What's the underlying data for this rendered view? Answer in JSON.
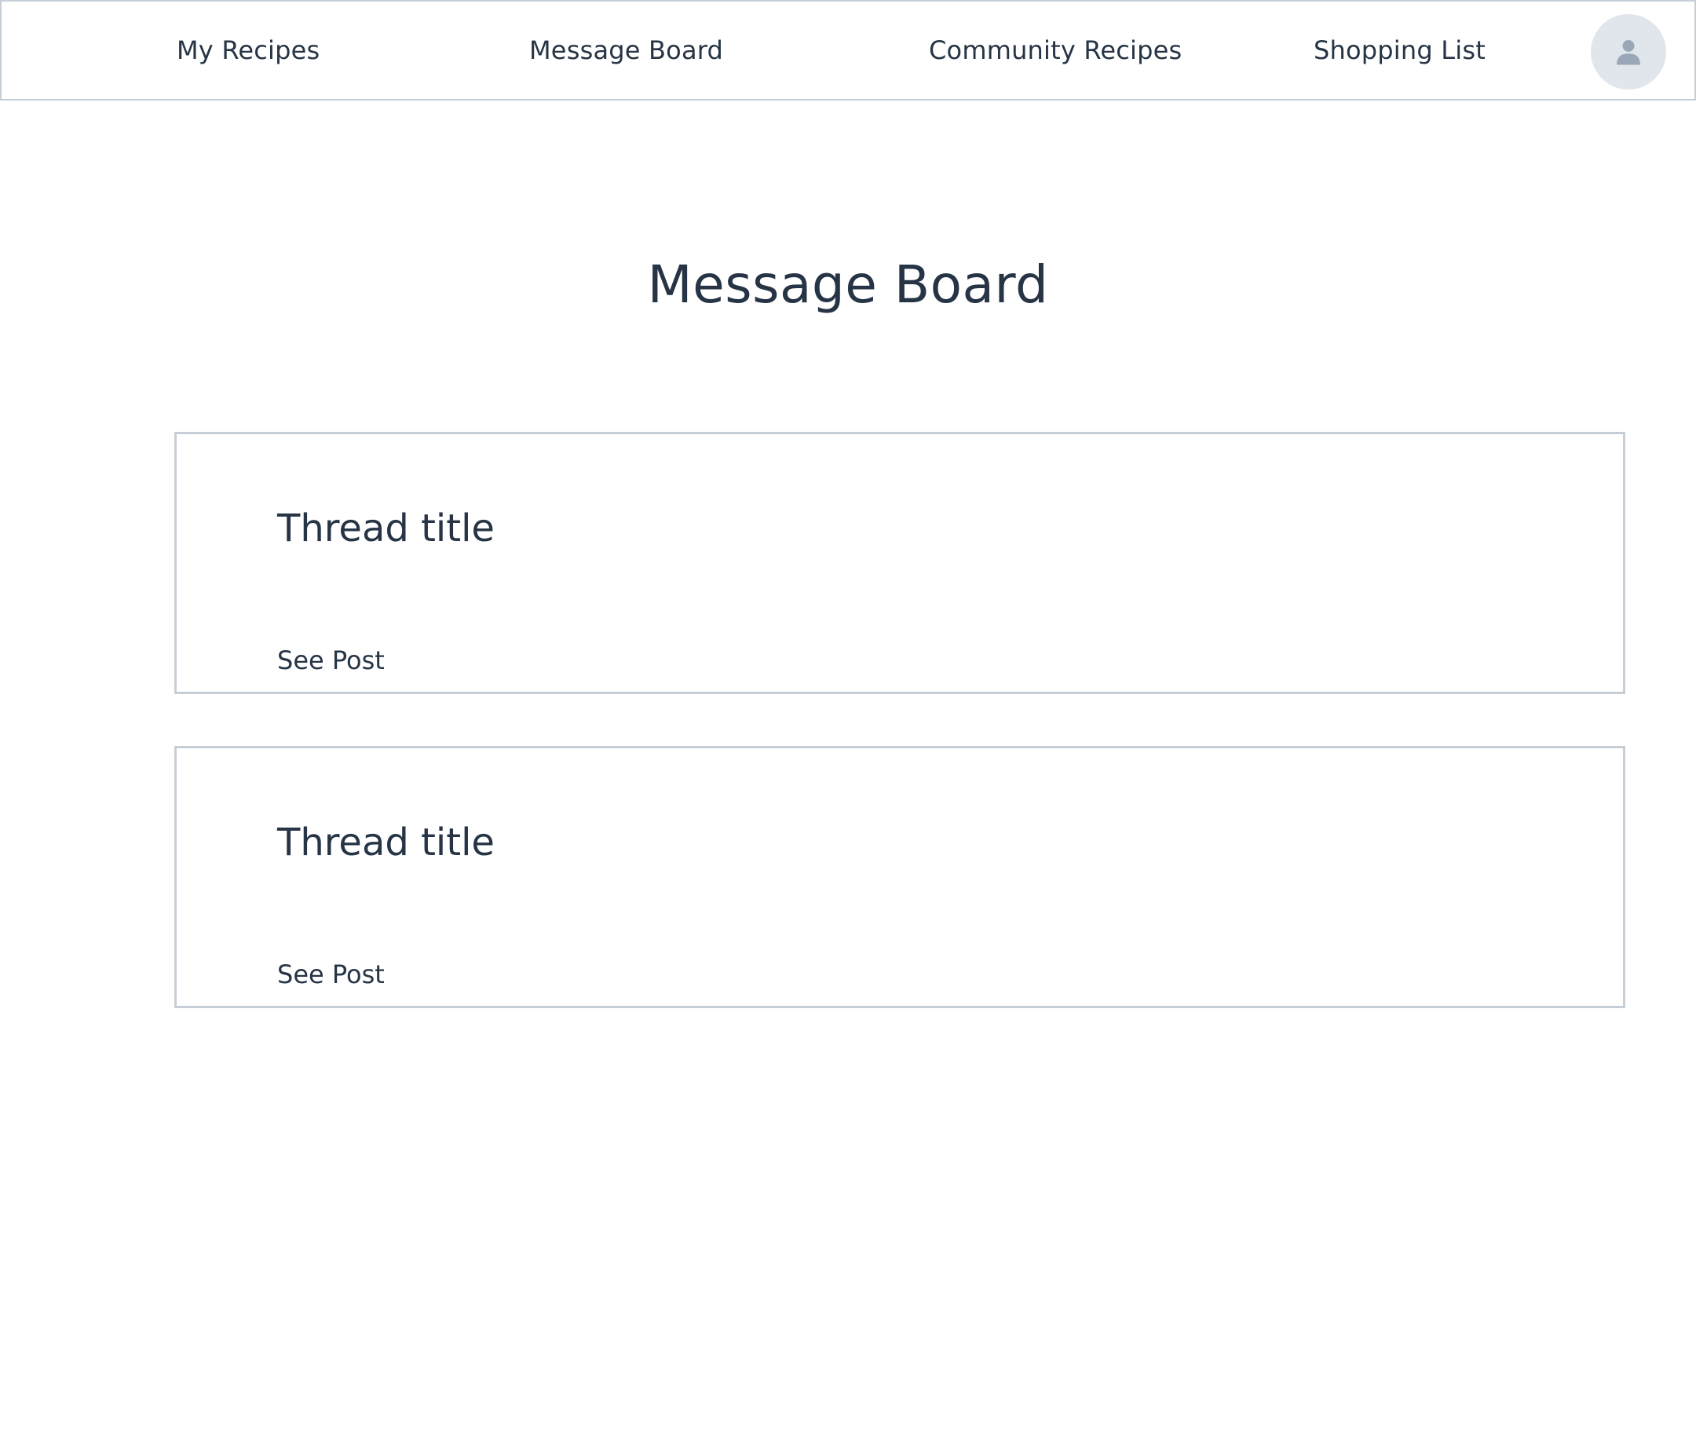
{
  "nav": {
    "items": [
      {
        "label": "My Recipes"
      },
      {
        "label": "Message Board"
      },
      {
        "label": "Community Recipes"
      },
      {
        "label": "Shopping List"
      }
    ],
    "avatar_icon": "user-icon"
  },
  "main": {
    "title": "Message Board",
    "threads": [
      {
        "title": "Thread title",
        "link_label": "See Post"
      },
      {
        "title": "Thread title",
        "link_label": "See Post"
      }
    ]
  },
  "colors": {
    "text": "#263445",
    "border": "#c6ced7",
    "avatar_bg": "#e1e6ec",
    "avatar_icon": "#9aa7b6"
  }
}
